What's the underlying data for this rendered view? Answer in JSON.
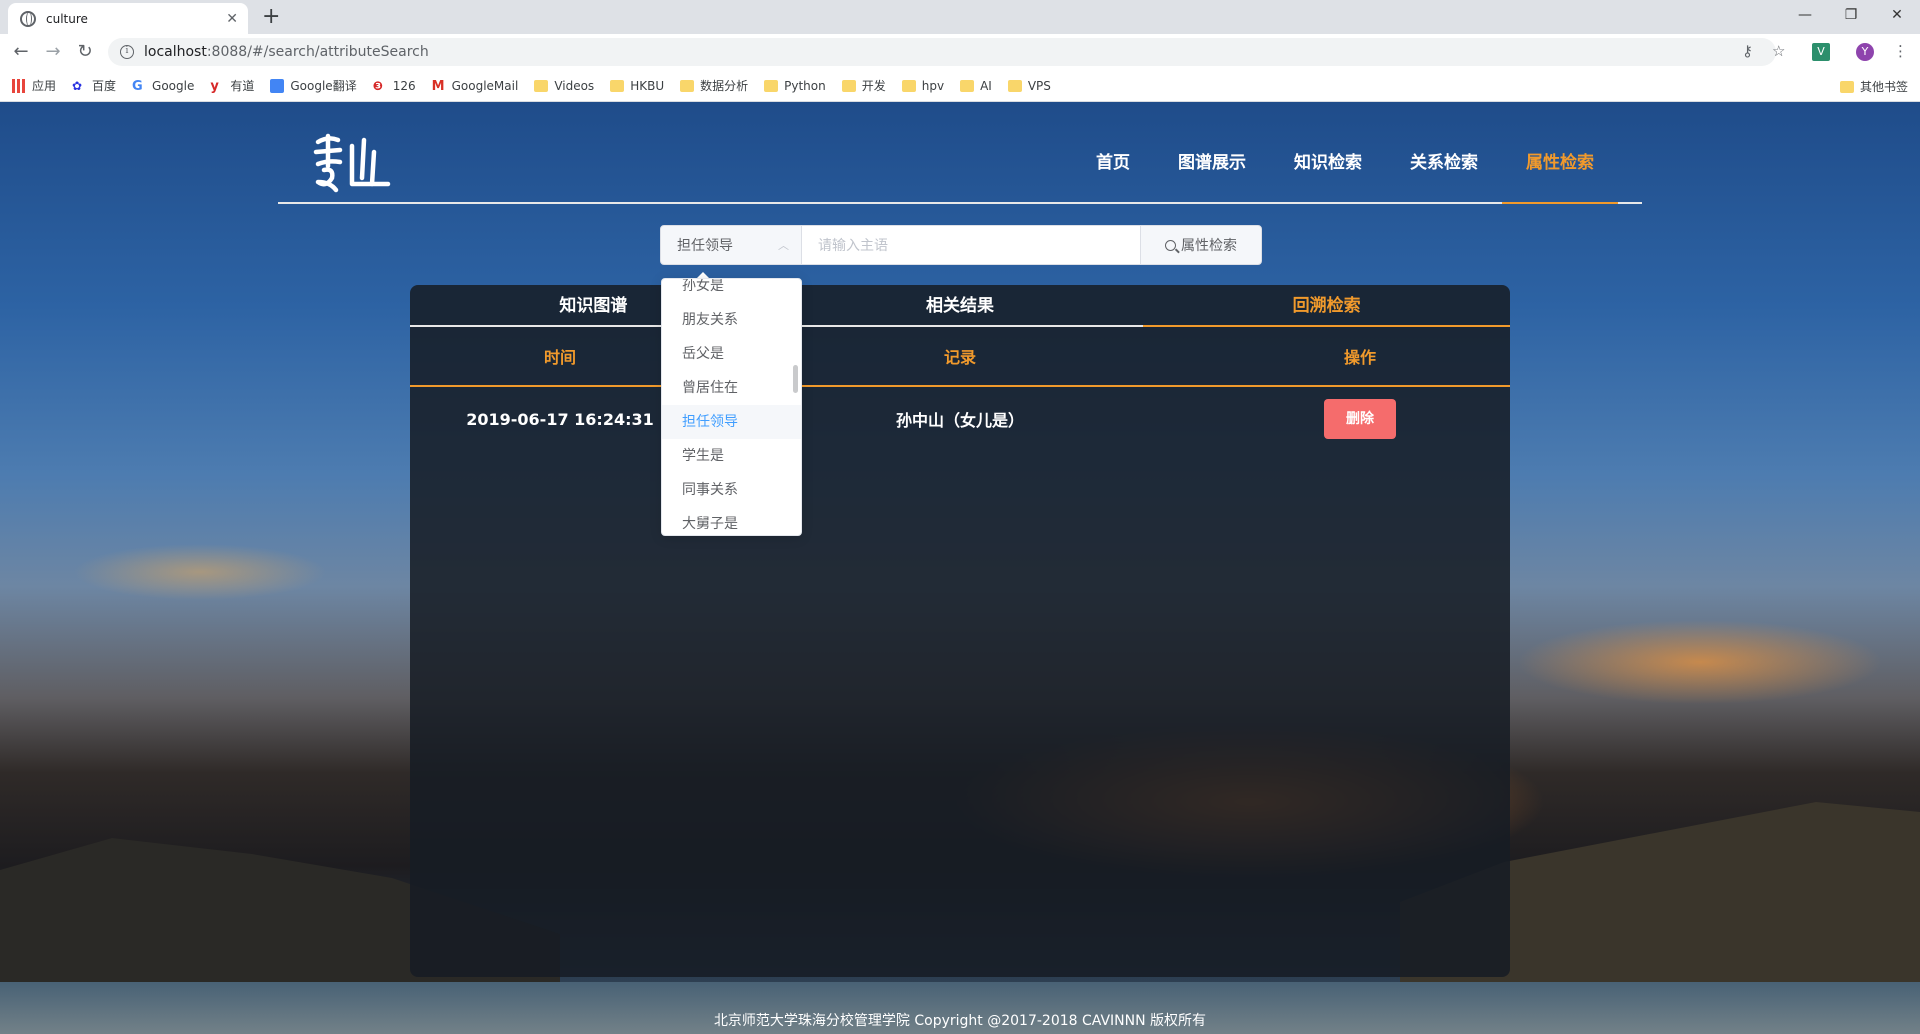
{
  "browser": {
    "tab_title": "culture",
    "url_host": "localhost",
    "url_path": ":8088/#/search/attributeSearch",
    "profile_initial": "Y",
    "bookmarks": [
      "应用",
      "百度",
      "Google",
      "有道",
      "Google翻译",
      "126",
      "GoogleMail",
      "Videos",
      "HKBU",
      "数据分析",
      "Python",
      "开发",
      "hpv",
      "AI",
      "VPS"
    ],
    "other_bookmarks": "其他书签"
  },
  "nav": {
    "items": [
      "首页",
      "图谱展示",
      "知识检索",
      "关系检索",
      "属性检索"
    ],
    "active_index": 4
  },
  "search": {
    "selected_attribute": "担任领导",
    "subject_placeholder": "请输入主语",
    "button_label": "属性检索"
  },
  "dropdown": {
    "options": [
      "孙女是",
      "朋友关系",
      "岳父是",
      "曾居住在",
      "担任领导",
      "学生是",
      "同事关系",
      "大舅子是"
    ],
    "selected": "担任领导"
  },
  "panel": {
    "tabs": [
      "知识图谱",
      "相关结果",
      "回溯检索"
    ],
    "active_tab": 2,
    "columns": [
      "时间",
      "记录",
      "操作"
    ],
    "rows": [
      {
        "time": "2019-06-17 16:24:31",
        "record": "孙中山（女儿是）",
        "action": "删除"
      }
    ]
  },
  "footer": "北京师范大学珠海分校管理学院 Copyright @2017-2018 CAVINNN 版权所有",
  "colors": {
    "accent": "#f19a2c",
    "danger": "#f56c6c",
    "selected": "#409eff"
  }
}
